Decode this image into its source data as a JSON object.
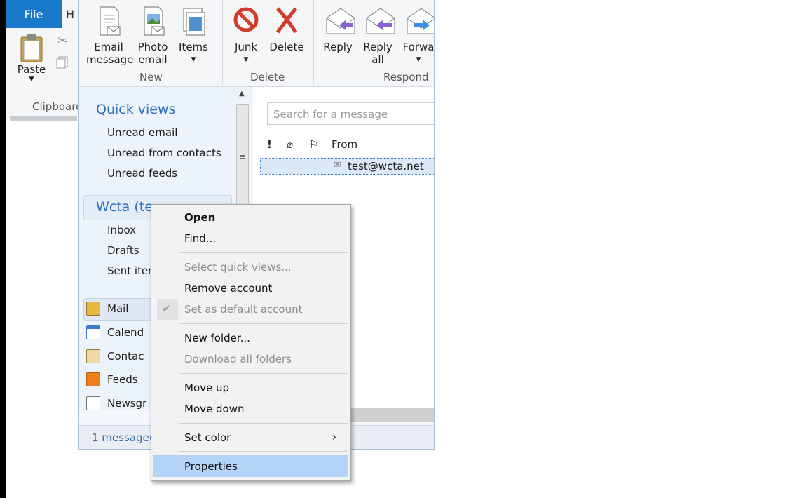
{
  "app": {
    "file_tab": "File",
    "home_tab_stub": "H",
    "clipboard": {
      "paste_label": "Paste",
      "group_label": "Clipboard"
    }
  },
  "ribbon": {
    "new_group": {
      "label": "New",
      "email_message": "Email message",
      "photo_email": "Photo email",
      "items": "Items"
    },
    "delete_group": {
      "label": "Delete",
      "junk": "Junk",
      "delete": "Delete"
    },
    "respond_group": {
      "label": "Respond",
      "reply": "Reply",
      "reply_all": "Reply all",
      "forward": "Forwa"
    }
  },
  "nav": {
    "quick_views_title": "Quick views",
    "quick_views": [
      "Unread email",
      "Unread from contacts",
      "Unread feeds"
    ],
    "account_title": "Wcta (te",
    "folders": [
      "Inbox",
      "Drafts",
      "Sent iter"
    ],
    "modules": [
      "Mail",
      "Calend",
      "Contac",
      "Feeds",
      "Newsgr"
    ]
  },
  "list": {
    "search_placeholder": "Search for a message",
    "column_from": "From",
    "rows": [
      {
        "from": "test@wcta.net"
      }
    ]
  },
  "status": {
    "text": "1 message("
  },
  "context_menu": {
    "items": [
      {
        "label": "Open",
        "enabled": true,
        "bold": true
      },
      {
        "label": "Find...",
        "enabled": true
      },
      {
        "label": "Select quick views...",
        "enabled": false
      },
      {
        "label": "Remove account",
        "enabled": true
      },
      {
        "label": "Set as default account",
        "enabled": false,
        "checked": true
      },
      {
        "label": "New folder...",
        "enabled": true
      },
      {
        "label": "Download all folders",
        "enabled": false
      },
      {
        "label": "Move up",
        "enabled": true
      },
      {
        "label": "Move down",
        "enabled": true
      },
      {
        "label": "Set color",
        "enabled": true,
        "submenu": true
      },
      {
        "label": "Properties",
        "enabled": true,
        "highlighted": true
      }
    ]
  },
  "colors": {
    "accent": "#1979ca",
    "nav_heading": "#2c6fbf",
    "highlight": "#b3d3f7",
    "disabled": "#8d8d8d"
  }
}
